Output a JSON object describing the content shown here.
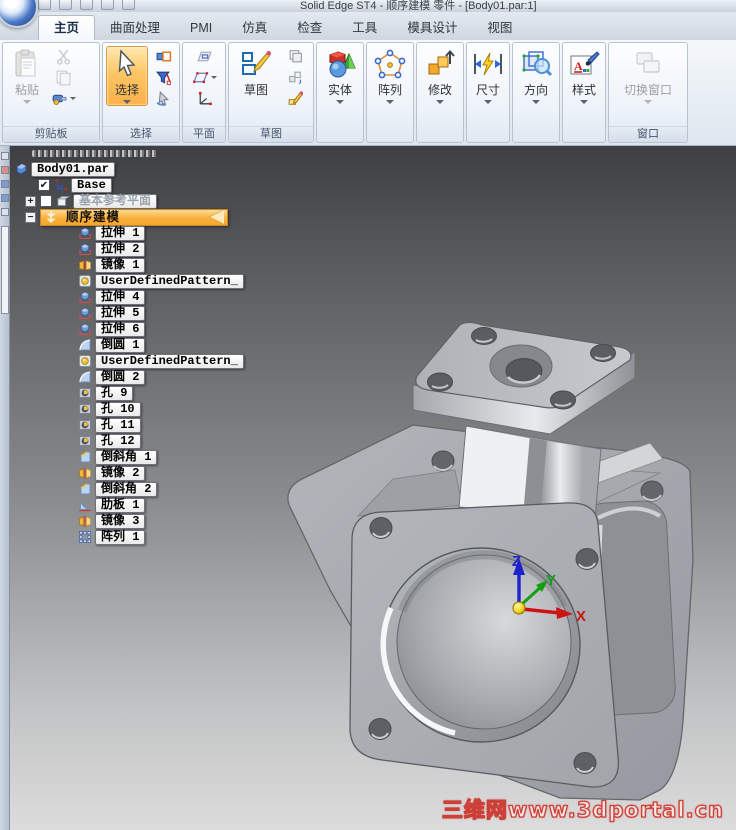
{
  "window": {
    "title": "Solid Edge ST4 - 顺序建模 零件 - [Body01.par:1]"
  },
  "tabs": [
    {
      "label": "主页",
      "active": true
    },
    {
      "label": "曲面处理"
    },
    {
      "label": "PMI"
    },
    {
      "label": "仿真"
    },
    {
      "label": "检查"
    },
    {
      "label": "工具"
    },
    {
      "label": "模具设计"
    },
    {
      "label": "视图"
    }
  ],
  "ribbon": {
    "clipboard": {
      "label": "剪贴板",
      "paste": "粘贴"
    },
    "select": {
      "label": "选择",
      "button": "选择"
    },
    "plane": {
      "label": "平面"
    },
    "sketch": {
      "label": "草图",
      "button": "草图"
    },
    "solids": {
      "button": "实体"
    },
    "pattern": {
      "button": "阵列"
    },
    "modify": {
      "button": "修改"
    },
    "dimension": {
      "button": "尺寸"
    },
    "orientation": {
      "button": "方向"
    },
    "style": {
      "button": "样式"
    },
    "window_group": {
      "label": "窗口",
      "button": "切换窗口"
    }
  },
  "pathfinder": {
    "items": [
      {
        "kind": "root",
        "icon": "part",
        "label": "Body01.par"
      },
      {
        "kind": "base",
        "icon": "csys",
        "label": "Base",
        "checked": true
      },
      {
        "kind": "planes",
        "icon": "planes",
        "label": "基本参考平面",
        "checked": false
      },
      {
        "kind": "ordered",
        "icon": "ordered",
        "label": "顺序建模"
      },
      {
        "kind": "feature",
        "icon": "extrude",
        "label": "拉伸 1"
      },
      {
        "kind": "feature",
        "icon": "extrude",
        "label": "拉伸 2"
      },
      {
        "kind": "feature",
        "icon": "mirror",
        "label": "镜像 1"
      },
      {
        "kind": "feature",
        "icon": "udp",
        "label": "UserDefinedPattern_"
      },
      {
        "kind": "feature",
        "icon": "extrude",
        "label": "拉伸 4"
      },
      {
        "kind": "feature",
        "icon": "extrude",
        "label": "拉伸 5"
      },
      {
        "kind": "feature",
        "icon": "extrude",
        "label": "拉伸 6"
      },
      {
        "kind": "feature",
        "icon": "round",
        "label": "倒圆 1"
      },
      {
        "kind": "feature",
        "icon": "udp",
        "label": "UserDefinedPattern_"
      },
      {
        "kind": "feature",
        "icon": "round",
        "label": "倒圆 2"
      },
      {
        "kind": "feature",
        "icon": "hole",
        "label": "孔 9"
      },
      {
        "kind": "feature",
        "icon": "hole",
        "label": "孔 10"
      },
      {
        "kind": "feature",
        "icon": "hole",
        "label": "孔 11"
      },
      {
        "kind": "feature",
        "icon": "hole",
        "label": "孔 12"
      },
      {
        "kind": "feature",
        "icon": "chamfer",
        "label": "倒斜角 1"
      },
      {
        "kind": "feature",
        "icon": "mirror",
        "label": "镜像 2"
      },
      {
        "kind": "feature",
        "icon": "chamfer",
        "label": "倒斜角 2"
      },
      {
        "kind": "feature",
        "icon": "rib",
        "label": "肋板 1"
      },
      {
        "kind": "feature",
        "icon": "mirror",
        "label": "镜像 3"
      },
      {
        "kind": "feature",
        "icon": "patternfeat",
        "label": "阵列 1"
      }
    ]
  },
  "viewport": {
    "triad": {
      "x": "X",
      "y": "Y",
      "z": "Z"
    },
    "watermark": "三维网www.3dportal.cn"
  },
  "colors": {
    "accent_orange": "#f9b049",
    "triad_x": "#cc1414",
    "triad_y": "#119911",
    "triad_z": "#2020cc",
    "watermark_red": "#cd4038",
    "model_gray": "#a9adb2"
  }
}
